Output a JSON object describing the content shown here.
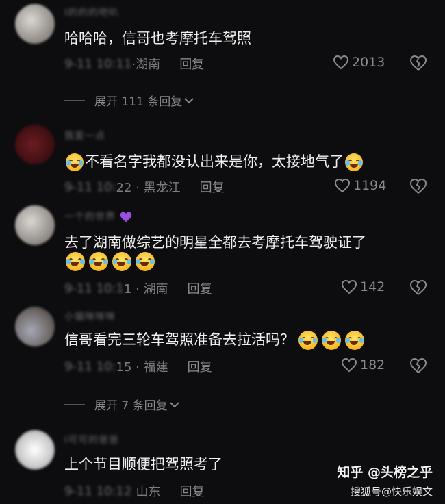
{
  "comments": [
    {
      "username": "Ⅰ的的的吧叭",
      "text": "哈哈哈，信哥也考摩托车驾照",
      "date": "9-11 10:11",
      "region": "·湖南",
      "reply": "回复",
      "likes": "2013"
    },
    {
      "username": "我爱一点",
      "text": "不看名字我都没认出来是你，太接地气了",
      "date": "9-11 10:",
      "region": "22 · 黑龙江",
      "reply": "回复",
      "likes": "1194"
    },
    {
      "username": "一个的世界",
      "text": "去了湖南做综艺的明星全都去考摩托车驾驶证了",
      "date": "9-11 10:1",
      "region": "1 · 湖南",
      "reply": "回复",
      "likes": "142"
    },
    {
      "username": "小猫咪咪咪",
      "text": "信哥看完三轮车驾照准备去拉活吗？",
      "date": "9-11 10:",
      "region": "15 · 福建",
      "reply": "回复",
      "likes": "182"
    },
    {
      "username": "Ⅰ可可的爸爸",
      "text": "上个节目顺便把驾照考了",
      "date": "9-11 10:12",
      "region": "山东",
      "reply": "回复",
      "likes": ""
    }
  ],
  "expand_1": "展开 111 条回复",
  "expand_2": "展开 7 条回复",
  "watermark": "知乎 @头榜之乎",
  "watermark_sub": "搜狐号@快乐娱文",
  "icons": {
    "like": "heart-outline-icon",
    "dislike": "broken-heart-icon",
    "expand": "chevron-down-icon"
  }
}
